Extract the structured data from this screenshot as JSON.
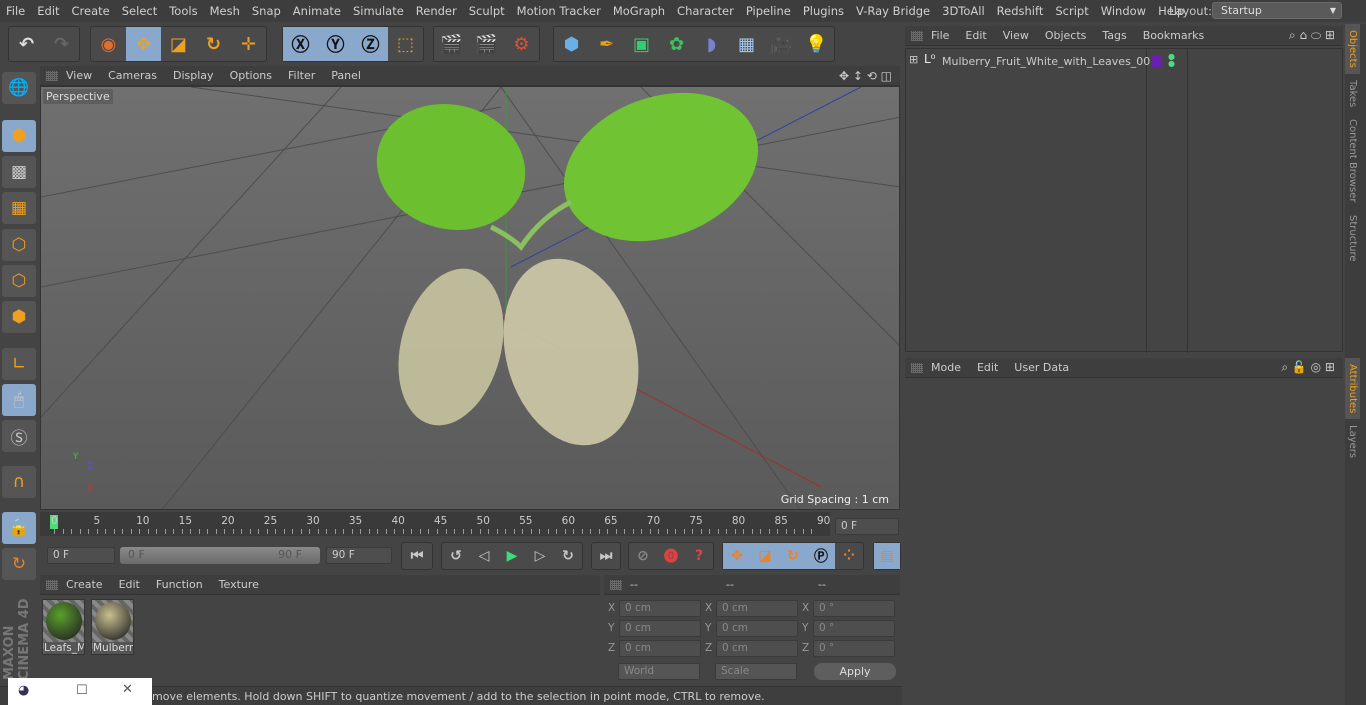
{
  "menu": [
    "File",
    "Edit",
    "Create",
    "Select",
    "Tools",
    "Mesh",
    "Snap",
    "Animate",
    "Simulate",
    "Render",
    "Sculpt",
    "Motion Tracker",
    "MoGraph",
    "Character",
    "Pipeline",
    "Plugins",
    "V-Ray Bridge",
    "3DToAll",
    "Redshift",
    "Script",
    "Window",
    "Help"
  ],
  "layout": {
    "label": "Layout:",
    "value": "Startup"
  },
  "viewport": {
    "menu": [
      "View",
      "Cameras",
      "Display",
      "Options",
      "Filter",
      "Panel"
    ],
    "camera": "Perspective",
    "grid_spacing": "Grid Spacing : 1 cm"
  },
  "timeline": {
    "ticks": [
      "0",
      "5",
      "10",
      "15",
      "20",
      "25",
      "30",
      "35",
      "40",
      "45",
      "50",
      "55",
      "60",
      "65",
      "70",
      "75",
      "80",
      "85",
      "90"
    ],
    "current": "0 F",
    "start": "0 F",
    "range_start": "0 F",
    "range_end": "90 F",
    "end": "90 F"
  },
  "materials": {
    "menu": [
      "Create",
      "Edit",
      "Function",
      "Texture"
    ],
    "items": [
      {
        "name": "Leafs_M",
        "color": "#5aa02c"
      },
      {
        "name": "Mulberr",
        "color": "#c8c090"
      }
    ]
  },
  "coords": {
    "headers": [
      "--",
      "--",
      "--"
    ],
    "rows": [
      {
        "axis": "X",
        "pos": "0 cm",
        "size": "0 cm",
        "rot": "0 °"
      },
      {
        "axis": "Y",
        "pos": "0 cm",
        "size": "0 cm",
        "rot": "0 °"
      },
      {
        "axis": "Z",
        "pos": "0 cm",
        "size": "0 cm",
        "rot": "0 °"
      }
    ],
    "mode1": "World",
    "mode2": "Scale",
    "apply": "Apply"
  },
  "objects": {
    "menu": [
      "File",
      "Edit",
      "View",
      "Objects",
      "Tags",
      "Bookmarks"
    ],
    "items": [
      {
        "name": "Mulberry_Fruit_White_with_Leaves_001",
        "tag_color": "#6a1fb0"
      }
    ]
  },
  "attributes": {
    "menu": [
      "Mode",
      "Edit",
      "User Data"
    ]
  },
  "right_tabs": [
    "Objects",
    "Takes",
    "Content Browser",
    "Structure"
  ],
  "right_tabs2": [
    "Attributes",
    "Layers"
  ],
  "status": "move elements. Hold down SHIFT to quantize movement / add to the selection in point mode, CTRL to remove.",
  "brand": "MAXON CINEMA 4D"
}
